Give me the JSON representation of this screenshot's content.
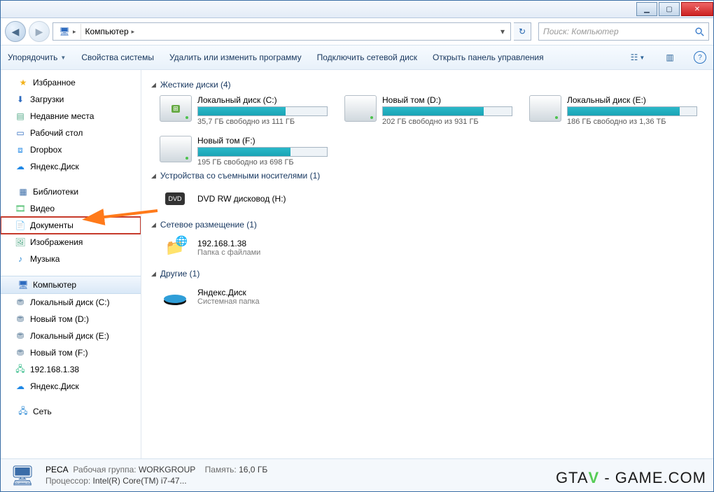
{
  "window": {
    "title_icons": {
      "minimize": "▁",
      "maximize": "▢",
      "close": "✕"
    }
  },
  "nav": {
    "location_segments": [
      "Компьютер"
    ],
    "refresh_icon": "↻",
    "search_placeholder": "Поиск: Компьютер"
  },
  "toolbar": {
    "organize": "Упорядочить",
    "system_props": "Свойства системы",
    "uninstall": "Удалить или изменить программу",
    "map_drive": "Подключить сетевой диск",
    "control_panel": "Открыть панель управления"
  },
  "sidebar": {
    "favorites": {
      "label": "Избранное",
      "items": [
        {
          "label": "Загрузки",
          "icon": "download"
        },
        {
          "label": "Недавние места",
          "icon": "recent"
        },
        {
          "label": "Рабочий стол",
          "icon": "desktop"
        },
        {
          "label": "Dropbox",
          "icon": "dropbox"
        },
        {
          "label": "Яндекс.Диск",
          "icon": "cloud"
        }
      ]
    },
    "libraries": {
      "label": "Библиотеки",
      "items": [
        {
          "label": "Видео",
          "icon": "video"
        },
        {
          "label": "Документы",
          "icon": "doc",
          "highlight": true
        },
        {
          "label": "Изображения",
          "icon": "image"
        },
        {
          "label": "Музыка",
          "icon": "music"
        }
      ]
    },
    "computer": {
      "label": "Компьютер",
      "items": [
        {
          "label": "Локальный диск (C:)",
          "icon": "cdrive"
        },
        {
          "label": "Новый том (D:)",
          "icon": "drive"
        },
        {
          "label": "Локальный диск (E:)",
          "icon": "drive"
        },
        {
          "label": "Новый том (F:)",
          "icon": "drive"
        },
        {
          "label": "192.168.1.38",
          "icon": "netdrive"
        },
        {
          "label": "Яндекс.Диск",
          "icon": "cloud"
        }
      ]
    },
    "network": {
      "label": "Сеть"
    }
  },
  "categories": {
    "hdd": {
      "label": "Жесткие диски (4)"
    },
    "removable": {
      "label": "Устройства со съемными носителями (1)"
    },
    "netloc": {
      "label": "Сетевое размещение (1)"
    },
    "other": {
      "label": "Другие (1)"
    }
  },
  "drives": [
    {
      "name": "Локальный диск (C:)",
      "stat": "35,7 ГБ свободно из 111 ГБ",
      "fill": 68
    },
    {
      "name": "Новый том (D:)",
      "stat": "202 ГБ свободно из 931 ГБ",
      "fill": 78
    },
    {
      "name": "Локальный диск (E:)",
      "stat": "186 ГБ свободно из 1,36 ТБ",
      "fill": 87
    },
    {
      "name": "Новый том (F:)",
      "stat": "195 ГБ свободно из 698 ГБ",
      "fill": 72
    }
  ],
  "removable": {
    "name": "DVD RW дисковод (H:)"
  },
  "netloc": {
    "name": "192.168.1.38",
    "sub": "Папка с файлами"
  },
  "otheritem": {
    "name": "Яндекс.Диск",
    "sub": "Системная папка"
  },
  "status": {
    "computer_name": "PECA",
    "workgroup_label": "Рабочая группа:",
    "workgroup": "WORKGROUP",
    "mem_label": "Память:",
    "mem": "16,0 ГБ",
    "cpu_label": "Процессор:",
    "cpu": "Intel(R) Core(TM) i7-47..."
  },
  "watermark": {
    "a": "GTA",
    "b": " - GAME.COM"
  }
}
